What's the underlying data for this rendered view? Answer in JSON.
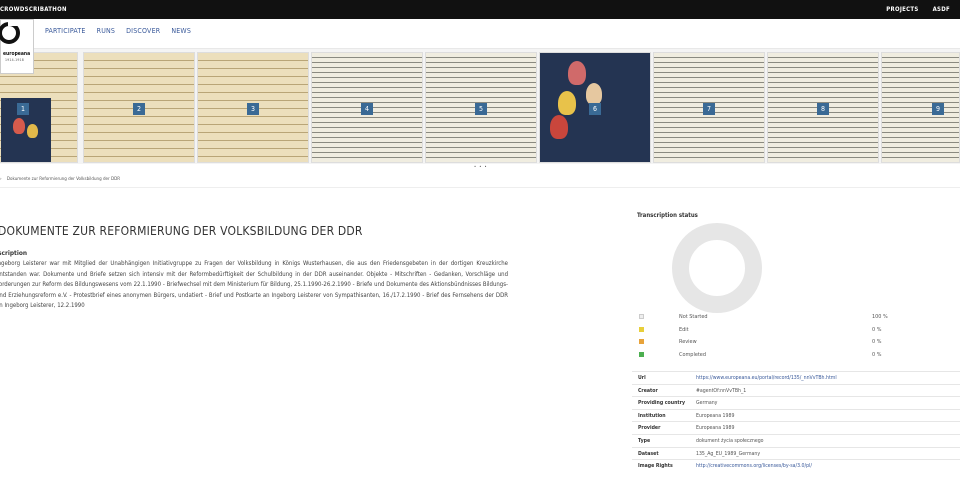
{
  "topbar": {
    "brand": "CROWDSCRIBATHON",
    "projects": "PROJECTS",
    "user": "ASDF"
  },
  "logo": {
    "line1": "europeana",
    "line2": "1914-1918"
  },
  "nav": {
    "links": [
      "PARTICIPATE",
      "RUNS",
      "DISCOVER",
      "NEWS"
    ]
  },
  "strip": {
    "numbers": [
      "1",
      "2",
      "3",
      "4",
      "5",
      "6",
      "7",
      "8",
      "9"
    ],
    "pager": "• • •"
  },
  "breadcrumb": {
    "sep": "›",
    "current": "Dokumente zur Reformierung der Volksbildung der DDR"
  },
  "story": {
    "title": "DOKUMENTE ZUR REFORMIERUNG DER VOLKSBILDUNG DER DDR",
    "description_heading": "scription",
    "description": "Ingeborg Leisterer war mit Mitglied der Unabhängigen Initiativgruppe zu Fragen der Volksbildung in Königs Wusterhausen, die aus den Friedensgebeten in der dortigen Kreuzkirche entstanden war. Dokumente und Briefe setzen sich intensiv mit der Reformbedürftigkeit der Schulbildung in der DDR auseinander. Objekte - Mitschriften - Gedanken, Vorschläge und Forderungen zur Reform des Bildungswesens vom 22.1.1990 - Briefwechsel mit dem Ministerium für Bildung, 25.1.1990-26.2.1990 - Briefe und Dokumente des Aktionsbündnisses Bildungs- und Erziehungsreform e.V. - Protestbrief eines anonymen Bürgers, undatiert - Brief und Postkarte an Ingeborg Leisterer von Sympathisanten, 16./17.2.1990 - Brief des Fernsehens der DDR an Ingeborg Leisterer, 12.2.1990"
  },
  "transcription": {
    "heading": "Transcription status",
    "statuses": [
      {
        "label": "Not Started",
        "pct": "100 %",
        "color": "#eeeeee"
      },
      {
        "label": "Edit",
        "pct": "0 %",
        "color": "#e8cf3a"
      },
      {
        "label": "Review",
        "pct": "0 %",
        "color": "#e8a33a"
      },
      {
        "label": "Completed",
        "pct": "0 %",
        "color": "#4caf50"
      }
    ]
  },
  "metadata": [
    {
      "key": "Url",
      "value": "https://www.europeana.eu/portal/record/135/_nnVvTBh.html"
    },
    {
      "key": "Creator",
      "value": "#agentOf:nnVvTBh_1"
    },
    {
      "key": "Providing country",
      "value": "Germany"
    },
    {
      "key": "Institution",
      "value": "Europeana 1989"
    },
    {
      "key": "Provider",
      "value": "Europeana 1989"
    },
    {
      "key": "Type",
      "value": "dokument życia społecznego"
    },
    {
      "key": "Dataset",
      "value": "135_Ag_EU_1989_Germany"
    },
    {
      "key": "Image Rights",
      "value": "http://creativecommons.org/licenses/by-sa/3.0/pl/"
    }
  ]
}
